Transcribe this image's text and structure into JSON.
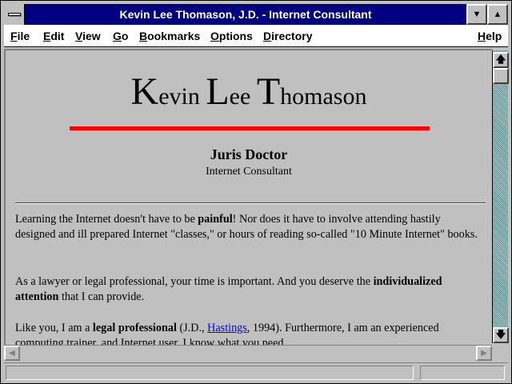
{
  "window": {
    "title": "Kevin Lee Thomason, J.D. - Internet Consultant",
    "minimize_glyph": "▼",
    "maximize_glyph": "▲"
  },
  "menu": {
    "items": [
      {
        "label_first": "F",
        "label_rest": "ile"
      },
      {
        "label_first": "E",
        "label_rest": "dit"
      },
      {
        "label_first": "V",
        "label_rest": "iew"
      },
      {
        "label_first": "G",
        "label_rest": "o"
      },
      {
        "label_first": "B",
        "label_rest": "ookmarks"
      },
      {
        "label_first": "O",
        "label_rest": "ptions"
      },
      {
        "label_first": "D",
        "label_rest": "irectory"
      },
      {
        "label_first": "H",
        "label_rest": "elp"
      }
    ]
  },
  "page": {
    "name": {
      "first_initial": "K",
      "first_rest": "evin ",
      "middle_initial": "L",
      "middle_rest": "ee ",
      "last_initial": "T",
      "last_rest": "homason"
    },
    "degree": "Juris Doctor",
    "role": "Internet Consultant",
    "p1": {
      "a": "Learning the Internet doesn't have to be ",
      "b_bold": "painful",
      "c": "! Nor does it have to involve attending hastily designed and ill prepared Internet \"classes,\" or hours of reading so-called \"10 Minute Internet\" books."
    },
    "p2": {
      "a": "As a lawyer or legal professional, your time is important. And you deserve the ",
      "b_bold": "individualized attention",
      "c": " that I can provide."
    },
    "p3": {
      "a": "Like you, I am a ",
      "b_bold": "legal professional",
      "c": " (J.D., ",
      "link": "Hastings",
      "d": ", 1994). Furthermore, I am an experienced computing trainer, and Internet user. I know what you need."
    }
  },
  "scroll": {
    "up_glyph": "🡅",
    "down_glyph": "🡇",
    "left_glyph": "◀",
    "right_glyph": "▶"
  },
  "status": {
    "text": ""
  },
  "colors": {
    "titlebar": "#000080",
    "accent_rule": "#ff0000",
    "link": "#0000ff"
  }
}
